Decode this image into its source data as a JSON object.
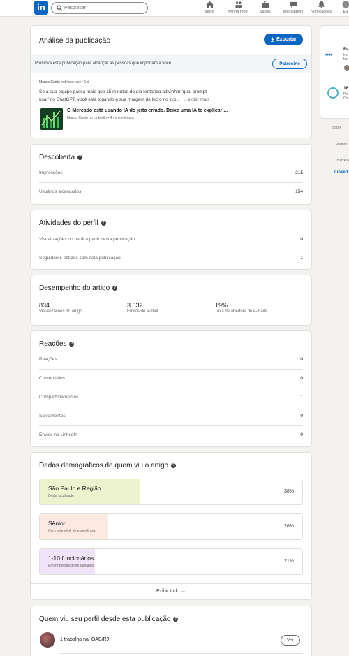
{
  "nav": {
    "search_placeholder": "Pesquisar",
    "items": [
      {
        "label": "Início",
        "icon": "home-icon"
      },
      {
        "label": "Minha rede",
        "icon": "network-icon"
      },
      {
        "label": "Vagas",
        "icon": "briefcase-icon"
      },
      {
        "label": "Mensagens",
        "icon": "messages-icon"
      },
      {
        "label": "Notificações",
        "icon": "bell-icon"
      },
      {
        "label": "Eu",
        "icon": "avatar-icon"
      }
    ]
  },
  "analysis": {
    "title": "Análise da publicação",
    "export_label": "Exportar",
    "promote_text": "Promova esta publicação para alcançar as pessoas que importam a você.",
    "sponsor_label": "Patrocine",
    "post": {
      "author": "Marcio Canto",
      "meta": "publicou isso • 1 d",
      "text_line1": "Se a sua equipe passa mais que 15 minutos do dia tentando adivinhar 'qual prompt",
      "text_line2": "usar' no ChatGPT, você está jogando a sua margem de lucro no lixo...",
      "show_more": "...exibir mais",
      "article_title": "O Mercado está usando IA do jeito errado. Deixe uma IA te explicar ...",
      "article_meta": "Marcio Canto no LinkedIn • 4 min de leitura"
    }
  },
  "discovery": {
    "title": "Descoberta",
    "rows": [
      {
        "label": "Impressões",
        "value": "215"
      },
      {
        "label": "Usuários alcançados",
        "value": "154"
      }
    ]
  },
  "profile_activity": {
    "title": "Atividades do perfil",
    "rows": [
      {
        "label": "Visualizações do perfil a partir desta publicação",
        "value": "0"
      },
      {
        "label": "Seguidores obtidos com esta publicação",
        "value": "1"
      }
    ]
  },
  "article_performance": {
    "title": "Desempenho do artigo",
    "stats": [
      {
        "value": "834",
        "label": "Visualizações do artigo"
      },
      {
        "value": "3.532",
        "label": "Envios de e-mail"
      },
      {
        "value": "19%",
        "label": "Taxa de abertura de e-mails"
      }
    ]
  },
  "reactions": {
    "title": "Reações",
    "rows": [
      {
        "label": "Reações",
        "value": "10"
      },
      {
        "label": "Comentários",
        "value": "0"
      },
      {
        "label": "Compartilhamentos",
        "value": "1"
      },
      {
        "label": "Salvamentos",
        "value": "0"
      },
      {
        "label": "Envios no LinkedIn",
        "value": "0"
      }
    ]
  },
  "demographics": {
    "title": "Dados demográficos de quem viu o artigo",
    "items": [
      {
        "name": "São Paulo e Região",
        "sub": "Desta localidade",
        "percent": "38%",
        "fraction": 0.38,
        "color": "#eef3cf"
      },
      {
        "name": "Sênior",
        "sub": "Com este nível de experiência",
        "percent": "26%",
        "fraction": 0.26,
        "color": "#fbe9e2"
      },
      {
        "name": "1-10 funcionários",
        "sub": "Em empresas deste tamanho",
        "percent": "21%",
        "fraction": 0.21,
        "color": "#efe4f8"
      }
    ],
    "show_all": "Exibir tudo →"
  },
  "viewers": {
    "title": "Quem viu seu perfil desde esta publicação",
    "item_prefix": "1 trabalha na",
    "item_org": "OAB/RJ",
    "view_label": "Ver"
  },
  "rail": {
    "item1_title": "Fa",
    "item1_text": "Inc",
    "item1_text2": "fan",
    "item2_title": "16",
    "item2_text": "Pe",
    "item2_text2": "Co",
    "footer": [
      "Sobre",
      "Preferê",
      "Baixe o",
      "Linked"
    ]
  }
}
